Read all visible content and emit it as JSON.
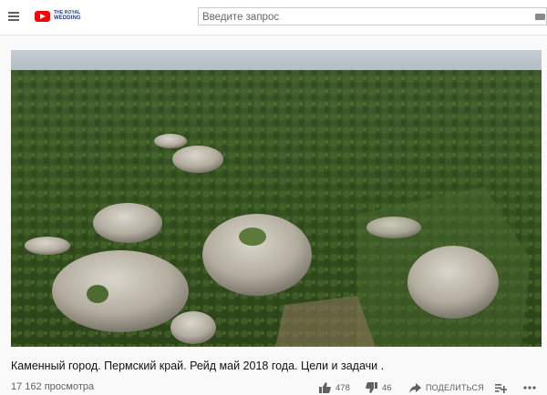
{
  "header": {
    "logo_line1": "THE ROYAL",
    "logo_line2": "WEDDING",
    "search_placeholder": "Введите запрос"
  },
  "video": {
    "title": "Каменный город. Пермский край. Рейд май 2018 года. Цели и задачи .",
    "views": "17 162 просмотра",
    "likes": "478",
    "dislikes": "46",
    "share_label": "Поделиться"
  },
  "colors": {
    "brand_red": "#ff0000",
    "logo_blue": "#1f3c8a",
    "muted_text": "#606060"
  }
}
